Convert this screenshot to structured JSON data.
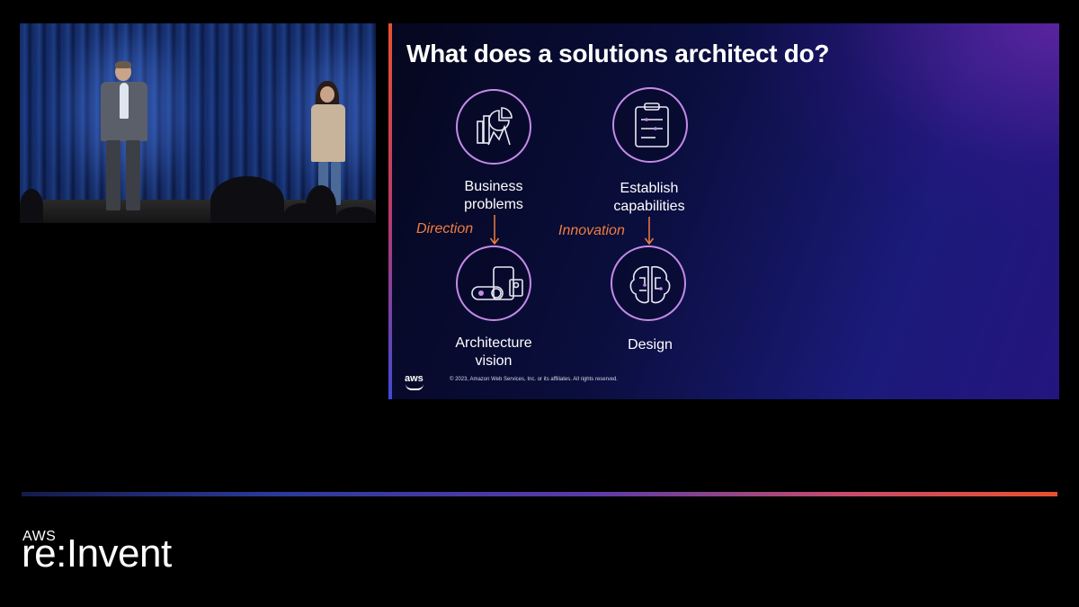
{
  "slide": {
    "title": "What does a solutions architect do?",
    "nodes": {
      "business": "Business\nproblems",
      "capabilities": "Establish\ncapabilities",
      "architecture": "Architecture\nvision",
      "design": "Design"
    },
    "flows": {
      "direction": "Direction",
      "innovation": "Innovation"
    },
    "footer": {
      "logo": "aws",
      "copyright": "© 2023, Amazon Web Services, Inc. or its affiliates. All rights reserved."
    },
    "colors": {
      "accent_orange": "#f07d3f",
      "icon_purple": "#c48ae8"
    }
  },
  "branding": {
    "event_prefix": "AWS",
    "event_name": "re:Invent"
  },
  "icons": [
    "analytics-chart-icon",
    "clipboard-icon",
    "devices-vision-icon",
    "brain-circuit-icon"
  ]
}
